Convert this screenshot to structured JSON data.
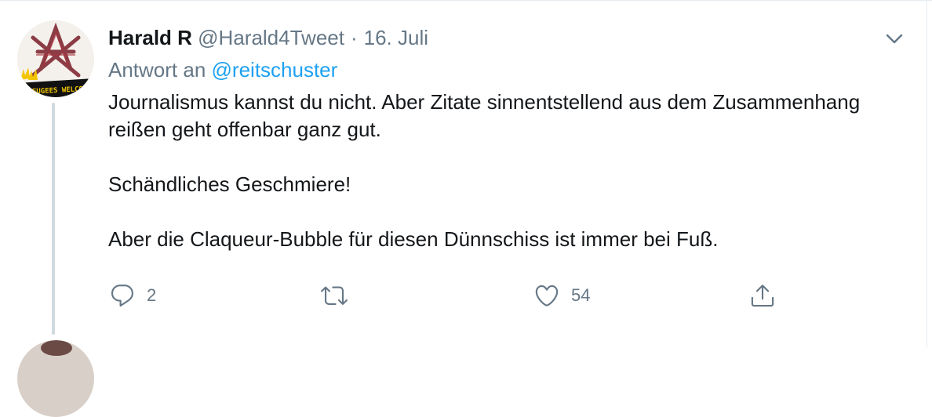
{
  "tweet": {
    "author_name": "Harald R",
    "handle": "@Harald4Tweet",
    "separator": "·",
    "date": "16. Juli",
    "reply_prefix": "Antwort an",
    "reply_mention": "@reitschuster",
    "paragraphs": [
      "Journalismus kannst du nicht. Aber Zitate sinnentstellend aus dem Zusammenhang reißen geht offenbar ganz gut.",
      "Schändliches Geschmiere!",
      "Aber die Claqueur-Bubble für diesen Dünnschiss ist immer bei Fuß."
    ]
  },
  "avatar": {
    "banner_text": "REFUGEES WELCOME",
    "colors": {
      "symbol": "#7a1d28",
      "banner": "#111111",
      "banner_text": "#f2c500"
    }
  },
  "actions": {
    "reply": {
      "icon": "reply-icon",
      "count": "2"
    },
    "retweet": {
      "icon": "retweet-icon",
      "count": ""
    },
    "like": {
      "icon": "heart-icon",
      "count": "54"
    },
    "share": {
      "icon": "share-icon"
    }
  },
  "colors": {
    "text": "#14171a",
    "secondary": "#657786",
    "link": "#1da1f2",
    "divider": "#e6ecf0",
    "thread_line": "#cfd9de"
  }
}
